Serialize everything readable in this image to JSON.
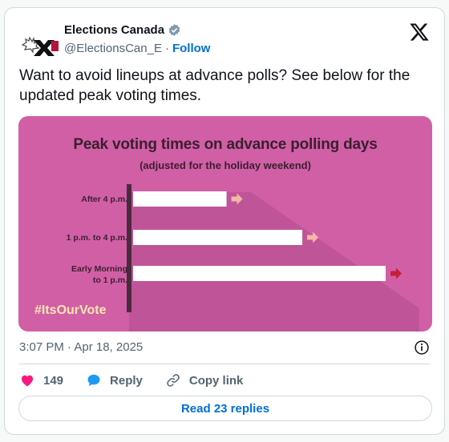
{
  "author": {
    "name": "Elections Canada",
    "handle": "@ElectionsCan_E",
    "separator": "·",
    "follow_label": "Follow",
    "verified_color": "#829aab"
  },
  "tweet": {
    "text": "Want to avoid lineups at advance polls? See below for the updated peak voting times."
  },
  "graphic": {
    "title": "Peak voting times on advance polling days",
    "subtitle": "(adjusted for the holiday weekend)",
    "hashtag": "#ItsOurVote",
    "background_color": "#d15fa6",
    "rows": [
      {
        "label_line1": "After 4 p.m.",
        "label_line2": "",
        "bar_fraction": 0.37,
        "arrow_color": "#f2b8a3"
      },
      {
        "label_line1": "1 p.m. to 4 p.m.",
        "label_line2": "",
        "bar_fraction": 0.67,
        "arrow_color": "#f2b8a3"
      },
      {
        "label_line1": "Early Morning",
        "label_line2": "to 1 p.m.",
        "bar_fraction": 1.0,
        "arrow_color": "#c0203c"
      }
    ]
  },
  "meta": {
    "timestamp": "3:07 PM · Apr 18, 2025"
  },
  "actions": {
    "like_count": "149",
    "reply_label": "Reply",
    "copy_label": "Copy link",
    "read_replies_label": "Read 23 replies"
  },
  "colors": {
    "link_blue": "#006fd6",
    "heart_pink": "#f91880",
    "reply_blue": "#1d9bf0"
  }
}
